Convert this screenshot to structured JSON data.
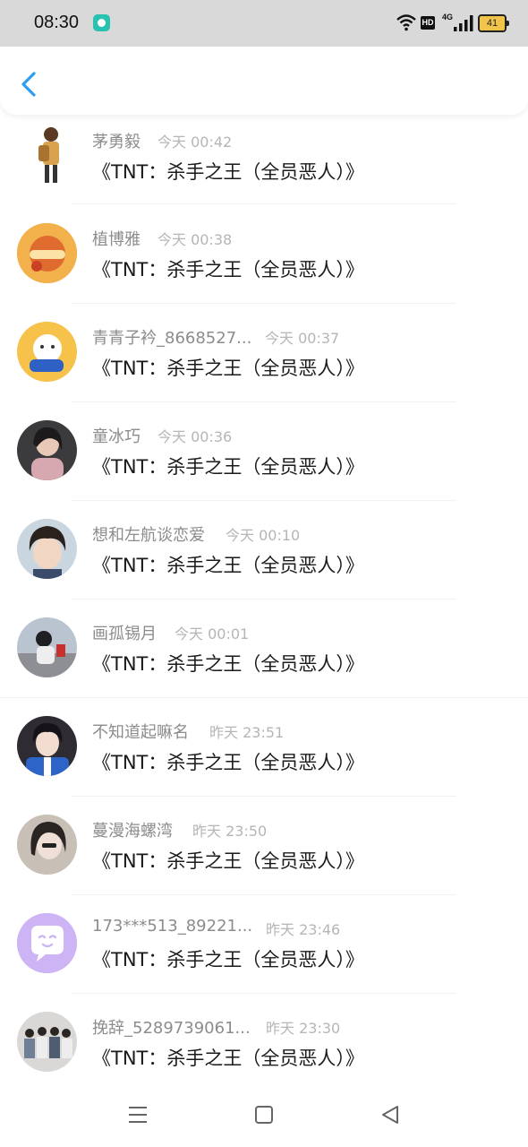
{
  "status_bar": {
    "time": "08:30",
    "hd_label": "HD",
    "network_label": "4G",
    "battery_level": "41"
  },
  "header": {
    "back_icon": "chevron-left-icon"
  },
  "colors": {
    "accent": "#2a9df4",
    "name_text": "#8c8c8c",
    "time_text": "#b5b5b5",
    "status_bar_bg": "#d9d9d9"
  },
  "items": [
    {
      "name": "茅勇毅",
      "time": "今天 00:42",
      "title": "《TNT：杀手之王（全员恶人）》"
    },
    {
      "name": "植博雅",
      "time": "今天 00:38",
      "title": "《TNT：杀手之王（全员恶人）》"
    },
    {
      "name": "青青子衿_8668527...",
      "time": "今天 00:37",
      "title": "《TNT：杀手之王（全员恶人）》"
    },
    {
      "name": "童冰巧",
      "time": "今天 00:36",
      "title": "《TNT：杀手之王（全员恶人）》"
    },
    {
      "name": "想和左航谈恋爱",
      "time": "今天 00:10",
      "title": "《TNT：杀手之王（全员恶人）》"
    },
    {
      "name": "画孤锡月",
      "time": "今天 00:01",
      "title": "《TNT：杀手之王（全员恶人）》"
    },
    {
      "name": "不知道起嘛名",
      "time": "昨天 23:51",
      "title": "《TNT：杀手之王（全员恶人）》"
    },
    {
      "name": "蔓漫海螺湾",
      "time": "昨天 23:50",
      "title": "《TNT：杀手之王（全员恶人）》"
    },
    {
      "name": "173***513_89221...",
      "time": "昨天 23:46",
      "title": "《TNT：杀手之王（全员恶人）》"
    },
    {
      "name": "挽辞_5289739061...",
      "time": "昨天 23:30",
      "title": "《TNT：杀手之王（全员恶人）》"
    }
  ],
  "nav_bar": {
    "icons": [
      "menu-icon",
      "home-square-icon",
      "back-triangle-icon"
    ]
  }
}
